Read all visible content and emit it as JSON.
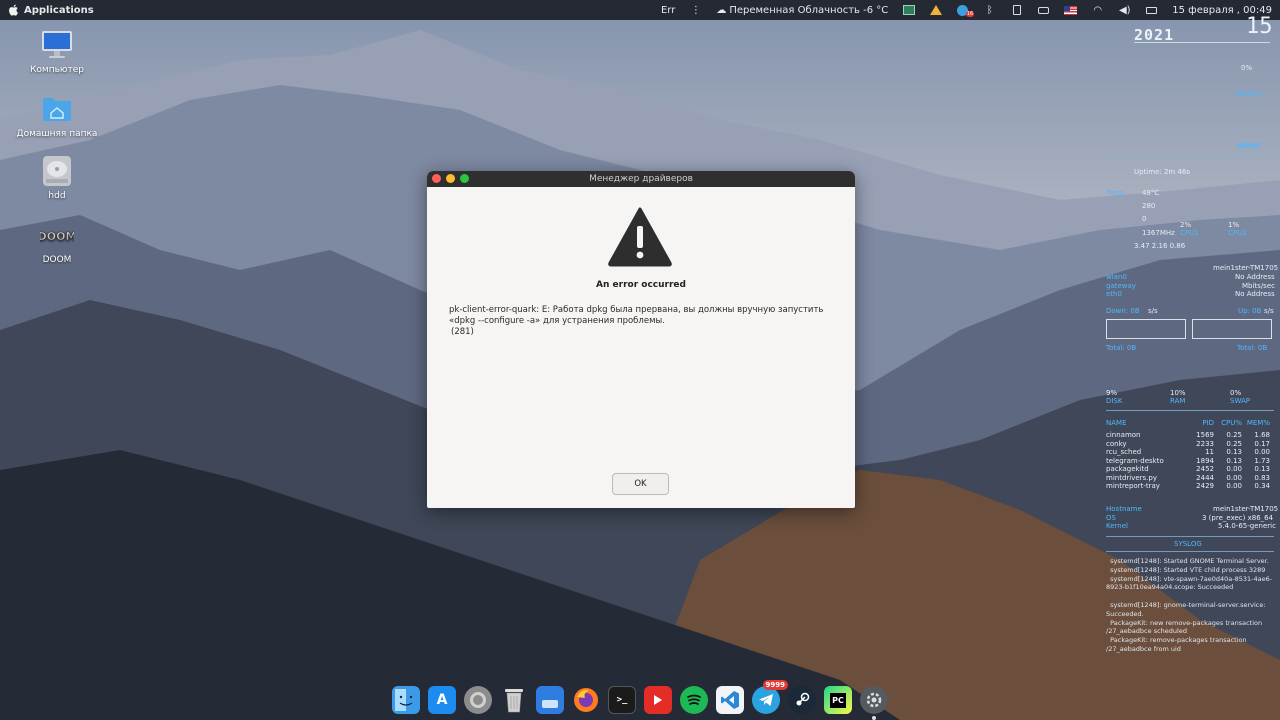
{
  "topbar": {
    "apps_label": "Applications",
    "err_label": "Err",
    "weather": "Переменная Облачность -6 °C",
    "clock": "15 февраля , 00:49",
    "tray_icons": [
      "display-icon",
      "vpn-icon",
      "telegram-icon",
      "bluetooth-icon",
      "clipboard-icon",
      "printer-icon",
      "keyboard-layout-us-icon",
      "wifi-icon",
      "volume-icon",
      "battery-icon"
    ],
    "telegram_badge": "16"
  },
  "desktop": {
    "icons": [
      {
        "label": "Компьютер",
        "icon": "computer-icon"
      },
      {
        "label": "Домашняя папка",
        "icon": "home-folder-icon"
      },
      {
        "label": "hdd",
        "icon": "drive-icon"
      },
      {
        "label": "DOOM",
        "icon": "doom-icon",
        "logo_text": "DOOM"
      }
    ]
  },
  "dialog": {
    "title": "Менеджер драйверов",
    "heading": "An error occurred",
    "message": "pk-client-error-quark: E: Работа dpkg была прервана, вы должны вручную запустить «dpkg --configure -a» для устранения проблемы.",
    "code": "(281)",
    "ok_label": "OK"
  },
  "conky": {
    "year": "2021",
    "day": "15",
    "percent": "0%",
    "battery_label": "Battery",
    "home_label": "HOME",
    "uptime": "Uptime: 2m 46s",
    "temp": "48°C",
    "stat1": "280",
    "stat2": "0",
    "freq": "1367MHz",
    "load": "3.47 2.16 0.86",
    "cpu_pct": "2%",
    "cpu_label": "CPU1",
    "cpu2_pct": "1%",
    "cpu2_label": "CPU2",
    "net_hostname": "mein1ster-TM1705",
    "net_rows": [
      {
        "label": "wlan0",
        "value": "No Address"
      },
      {
        "label": "gateway",
        "value": "Mbits/sec"
      },
      {
        "label": "eth0",
        "value": "No Address"
      }
    ],
    "down_label": "Down: 0B",
    "down_unit": "s/s",
    "up_label": "Up: 0B",
    "up_unit": "s/s",
    "total_down": "Total: 0B",
    "total_up": "Total: 0B",
    "disk_pct": "9%",
    "disk_label": "DISK",
    "ram_pct": "10%",
    "ram_label": "RAM",
    "swap_pct": "0%",
    "swap_label": "SWAP",
    "proc_headers": {
      "name": "NAME",
      "pid": "PID",
      "cpu": "CPU%",
      "mem": "MEM%"
    },
    "processes": [
      {
        "name": "cinnamon",
        "pid": "1569",
        "cpu": "0.25",
        "mem": "1.68"
      },
      {
        "name": "conky",
        "pid": "2233",
        "cpu": "0.25",
        "mem": "0.17"
      },
      {
        "name": "rcu_sched",
        "pid": "11",
        "cpu": "0.13",
        "mem": "0.00"
      },
      {
        "name": "telegram-deskto",
        "pid": "1894",
        "cpu": "0.13",
        "mem": "1.73"
      },
      {
        "name": "packagekitd",
        "pid": "2452",
        "cpu": "0.00",
        "mem": "0.13"
      },
      {
        "name": "mintdrivers.py",
        "pid": "2444",
        "cpu": "0.00",
        "mem": "0.83"
      },
      {
        "name": "mintreport-tray",
        "pid": "2429",
        "cpu": "0.00",
        "mem": "0.34"
      }
    ],
    "sys_labels": [
      "Hostname",
      "OS",
      "Kernel"
    ],
    "sys_values": [
      "mein1ster-TM1705",
      "3 (pre_exec) x86_64",
      "5.4.0-65-generic"
    ],
    "syslog_title": "SYSLOG",
    "syslog": "  systemd[1248]: Started GNOME Terminal Server.\n  systemd[1248]: Started VTE child process 3289\n  systemd[1248]: vte-spawn-7ae0d40a-8531-4ae6-8923-b1f10ea94a04.scope: Succeeded\n\n  systemd[1248]: gnome-terminal-server.service: Succeeded.\n  PackageKit: new remove-packages transaction /27_aebadbce scheduled\n  PackageKit: remove-packages transaction /27_aebadbce from uid"
  },
  "dock": {
    "items": [
      {
        "name": "finder",
        "icon": "finder-icon",
        "color": "#3c9be8"
      },
      {
        "name": "app-store",
        "icon": "app-store-icon",
        "color": "#1c8cf0"
      },
      {
        "name": "system-settings",
        "icon": "settings-wheel-icon",
        "color": "#8c8c8c"
      },
      {
        "name": "trash",
        "icon": "trash-icon",
        "color": "#c9c9c9"
      },
      {
        "name": "files",
        "icon": "files-icon",
        "color": "#2f7de1"
      },
      {
        "name": "firefox",
        "icon": "firefox-icon",
        "color": "#ff7b1f"
      },
      {
        "name": "terminal",
        "icon": "terminal-icon",
        "color": "#1b1b1b"
      },
      {
        "name": "youtube",
        "icon": "youtube-icon",
        "color": "#e52d27"
      },
      {
        "name": "spotify",
        "icon": "spotify-icon",
        "color": "#1db954"
      },
      {
        "name": "vscode",
        "icon": "vscode-icon",
        "color": "#2a88d4"
      },
      {
        "name": "telegram",
        "icon": "telegram-icon",
        "color": "#2aa3e0",
        "badge": "9999"
      },
      {
        "name": "steam",
        "icon": "steam-icon",
        "color": "#1b2838"
      },
      {
        "name": "pycharm",
        "icon": "pycharm-icon",
        "color": "#21d789",
        "text": "PC"
      },
      {
        "name": "system-preferences",
        "icon": "gear-icon",
        "color": "#555a60",
        "active": true
      }
    ]
  }
}
